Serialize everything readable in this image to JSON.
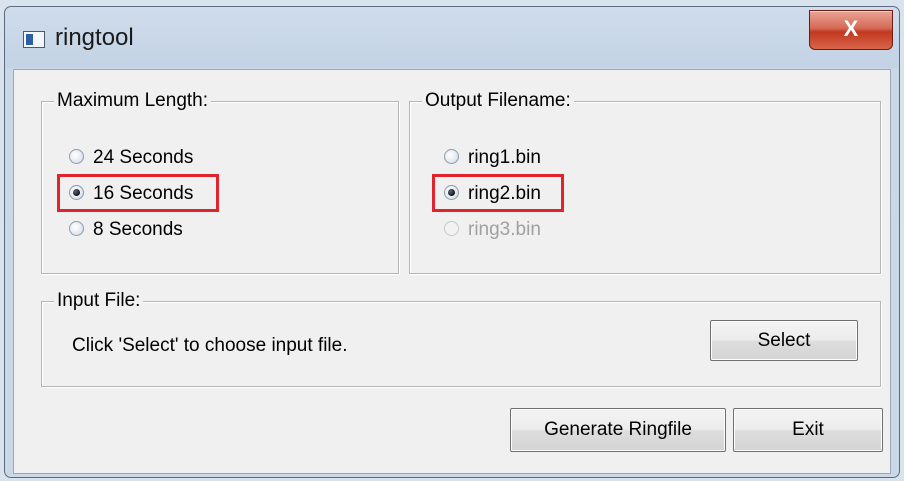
{
  "window": {
    "title": "ringtool",
    "close_label": "X"
  },
  "max_length": {
    "legend": "Maximum Length:",
    "options": [
      {
        "label": "24 Seconds",
        "checked": false
      },
      {
        "label": "16 Seconds",
        "checked": true
      },
      {
        "label": "8 Seconds",
        "checked": false
      }
    ]
  },
  "output_filename": {
    "legend": "Output Filename:",
    "options": [
      {
        "label": "ring1.bin",
        "checked": false
      },
      {
        "label": "ring2.bin",
        "checked": true
      },
      {
        "label": "ring3.bin",
        "checked": false,
        "disabled": true
      }
    ]
  },
  "input_file": {
    "legend": "Input File:",
    "status": "Click 'Select' to choose input file.",
    "select_label": "Select"
  },
  "actions": {
    "generate_label": "Generate Ringfile",
    "exit_label": "Exit"
  },
  "colors": {
    "highlight": "#e0232d",
    "close_button": "#c0391f"
  }
}
